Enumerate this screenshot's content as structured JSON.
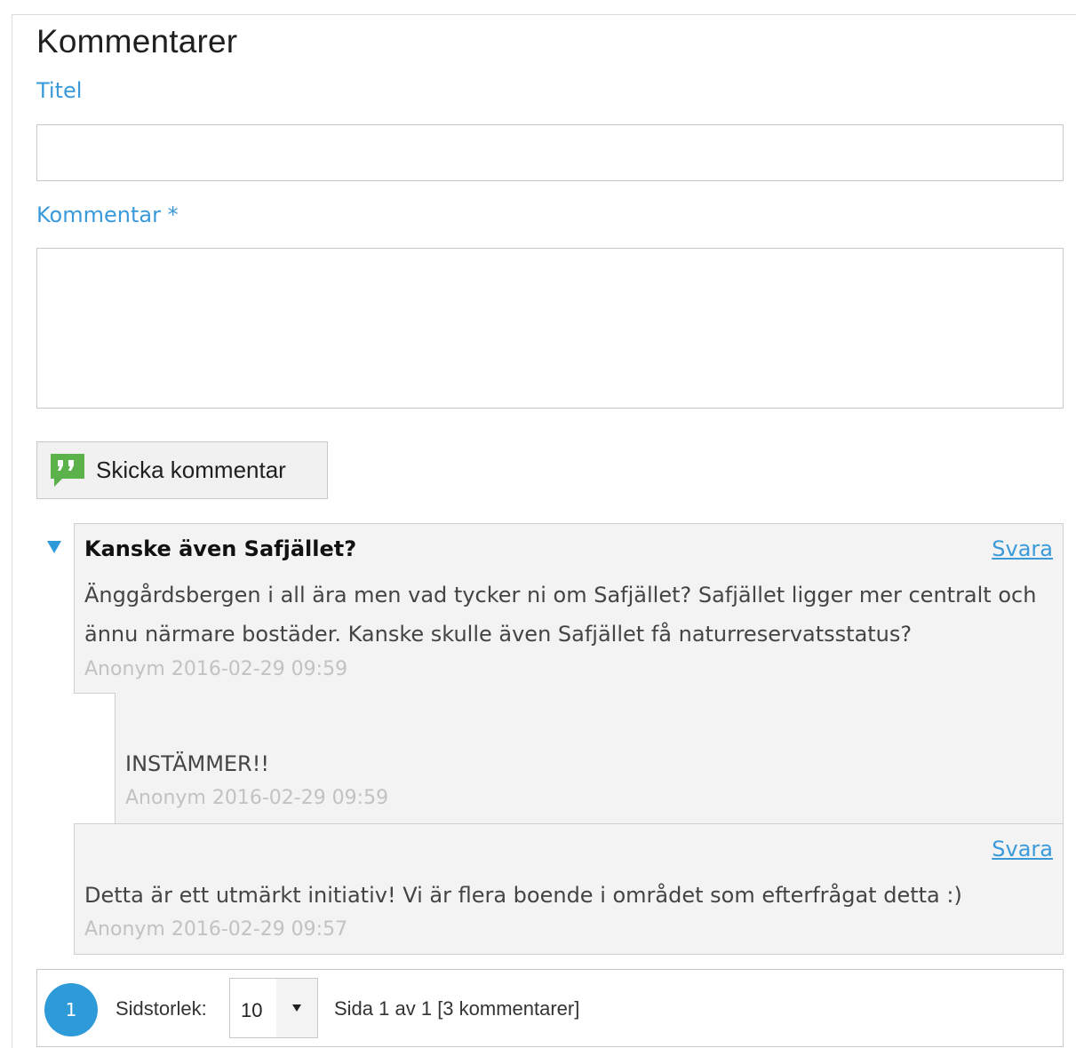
{
  "section": {
    "title": "Kommentarer"
  },
  "form": {
    "title_label": "Titel",
    "title_value": "",
    "comment_label": "Kommentar *",
    "comment_value": "",
    "submit_label": "Skicka kommentar"
  },
  "comments": [
    {
      "title": "Kanske även Safjället?",
      "reply_label": "Svara",
      "body": "Änggårdsbergen i all ära men vad tycker ni om Safjället? Safjället ligger mer centralt och ännu närmare bostäder. Kanske skulle även Safjället få naturreservatsstatus?",
      "meta": "Anonym 2016-02-29 09:59",
      "expanded": true
    },
    {
      "body": "INSTÄMMER!!",
      "meta": "Anonym 2016-02-29 09:59",
      "reply_to": 0
    },
    {
      "reply_label": "Svara",
      "body": "Detta är ett utmärkt initiativ! Vi är flera boende i området som efterfrågat detta :)",
      "meta": "Anonym 2016-02-29 09:57"
    }
  ],
  "pager": {
    "current_page": "1",
    "size_label": "Sidstorlek:",
    "size_value": "10",
    "info": "Sida 1 av 1 [3 kommentarer]"
  },
  "colors": {
    "accent": "#3a9ad9",
    "submit_icon": "#5bb24a",
    "comment_bg": "#f3f3f3",
    "meta": "#c2c2c2"
  },
  "icons": {
    "submit": "speech-bubble-quote-icon",
    "toggle": "triangle-down-icon",
    "select_arrow": "caret-down-icon"
  }
}
